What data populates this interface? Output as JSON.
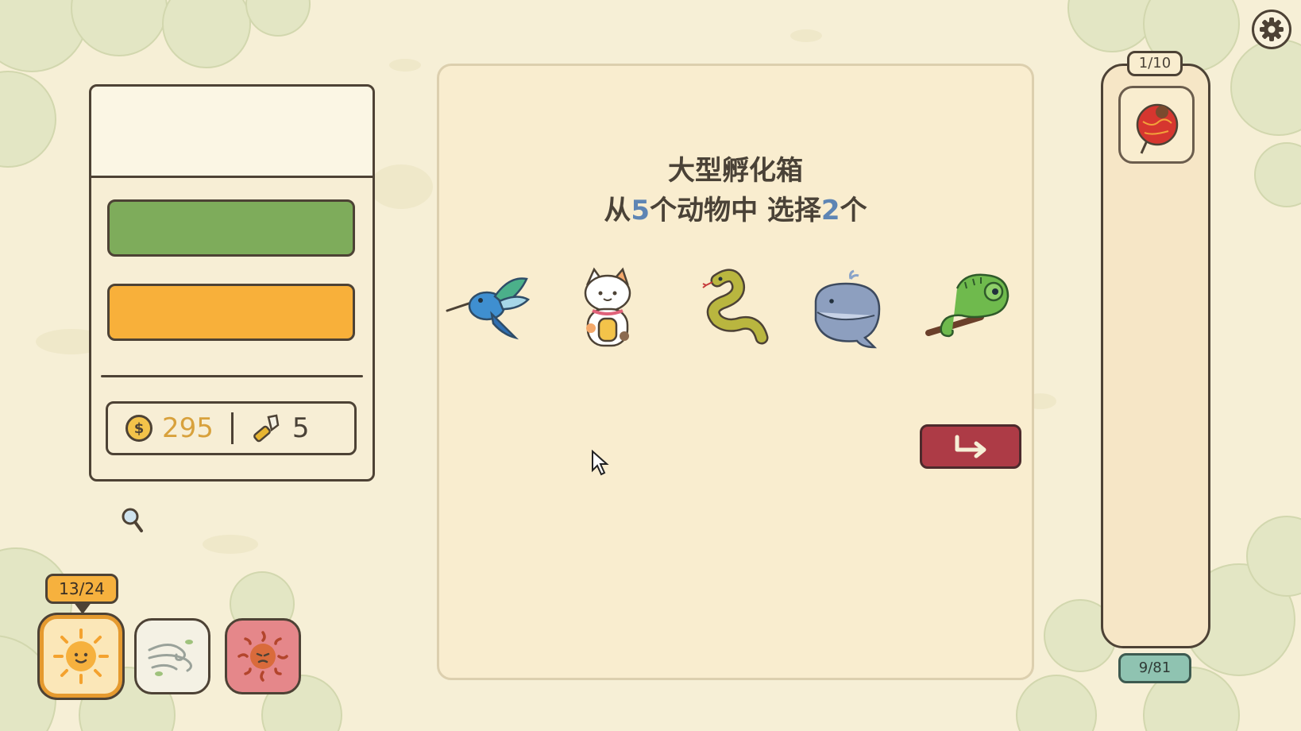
{
  "resources": {
    "coins": "295",
    "tools": "5",
    "coin_symbol": "$"
  },
  "incubator": {
    "title": "大型孵化箱",
    "subtitle": {
      "prefix": "从",
      "total": "5",
      "mid": "个动物中 选择",
      "pick": "2",
      "suffix": "个"
    },
    "animals": [
      {
        "name": "hummingbird"
      },
      {
        "name": "lucky-cat"
      },
      {
        "name": "snake"
      },
      {
        "name": "whale"
      },
      {
        "name": "chameleon"
      }
    ],
    "next_button_icon": "arrow-turn-right-icon"
  },
  "collection": {
    "page": "1/10",
    "count": "9/81",
    "slot_icon": "lantern-icon"
  },
  "day": {
    "counter": "13/24"
  },
  "weather": [
    {
      "name": "sunny",
      "icon": "sun-icon",
      "selected": true
    },
    {
      "name": "windy",
      "icon": "wind-icon",
      "selected": false
    },
    {
      "name": "heatwave",
      "icon": "heat-sun-icon",
      "selected": false
    }
  ],
  "colors": {
    "background": "#f6efd6",
    "bar_green": "#7eac5b",
    "bar_orange": "#f8b03a",
    "next_button": "#ad3b46",
    "count_badge": "#8fc3b1",
    "number_accent": "#5e85b4"
  }
}
